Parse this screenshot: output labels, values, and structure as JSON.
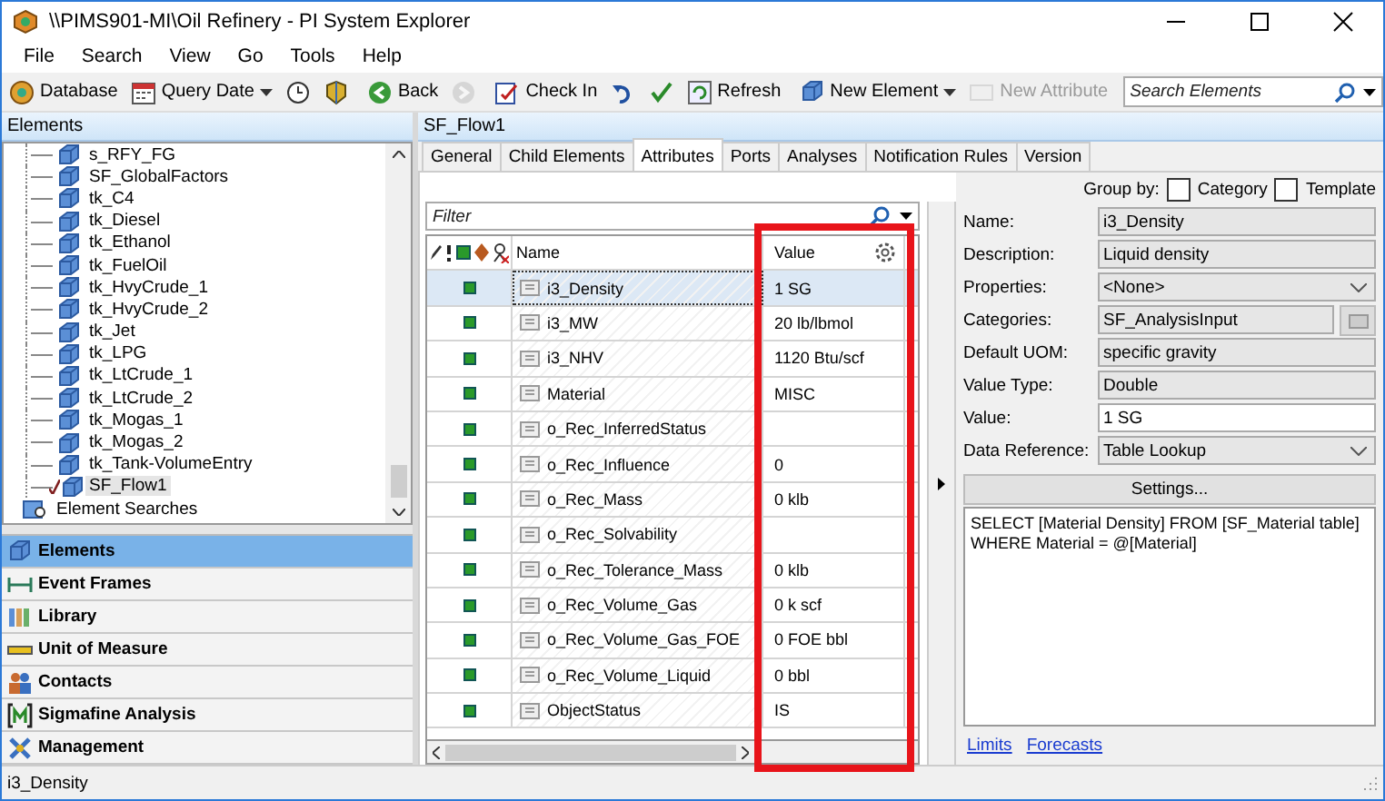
{
  "window": {
    "title": "\\\\PIMS901-MI\\Oil Refinery - PI System Explorer"
  },
  "menu": [
    "File",
    "Search",
    "View",
    "Go",
    "Tools",
    "Help"
  ],
  "toolbar": [
    {
      "kind": "button",
      "label": "Database",
      "disabled": false
    },
    {
      "kind": "dropdown",
      "label": "Query Date",
      "disabled": false
    },
    {
      "kind": "icon",
      "disabled": false
    },
    {
      "kind": "icon",
      "disabled": false
    },
    {
      "kind": "separator"
    },
    {
      "kind": "button",
      "label": "Back",
      "disabled": false
    },
    {
      "kind": "icon",
      "disabled": true
    },
    {
      "kind": "separator"
    },
    {
      "kind": "button",
      "label": "Check In",
      "disabled": false
    },
    {
      "kind": "icon",
      "disabled": false
    },
    {
      "kind": "icon",
      "disabled": false
    },
    {
      "kind": "button",
      "label": "Refresh",
      "disabled": false
    },
    {
      "kind": "separator"
    },
    {
      "kind": "dropdown",
      "label": "New Element",
      "disabled": false
    },
    {
      "kind": "button",
      "label": "New Attribute",
      "disabled": true
    },
    {
      "kind": "separator"
    }
  ],
  "search": {
    "placeholder": "Search Elements"
  },
  "elements_panel": {
    "title": "Elements",
    "tree": [
      {
        "label": "s_RFY_FG",
        "selected": false,
        "checked_out": false
      },
      {
        "label": "SF_GlobalFactors",
        "selected": false,
        "checked_out": false
      },
      {
        "label": "tk_C4",
        "selected": false,
        "checked_out": false
      },
      {
        "label": "tk_Diesel",
        "selected": false,
        "checked_out": false
      },
      {
        "label": "tk_Ethanol",
        "selected": false,
        "checked_out": false
      },
      {
        "label": "tk_FuelOil",
        "selected": false,
        "checked_out": false
      },
      {
        "label": "tk_HvyCrude_1",
        "selected": false,
        "checked_out": false
      },
      {
        "label": "tk_HvyCrude_2",
        "selected": false,
        "checked_out": false
      },
      {
        "label": "tk_Jet",
        "selected": false,
        "checked_out": false
      },
      {
        "label": "tk_LPG",
        "selected": false,
        "checked_out": false
      },
      {
        "label": "tk_LtCrude_1",
        "selected": false,
        "checked_out": false
      },
      {
        "label": "tk_LtCrude_2",
        "selected": false,
        "checked_out": false
      },
      {
        "label": "tk_Mogas_1",
        "selected": false,
        "checked_out": false
      },
      {
        "label": "tk_Mogas_2",
        "selected": false,
        "checked_out": false
      },
      {
        "label": "tk_Tank-VolumeEntry",
        "selected": false,
        "checked_out": false
      },
      {
        "label": "SF_Flow1",
        "selected": true,
        "checked_out": true
      }
    ],
    "searches": {
      "label": "Element Searches"
    }
  },
  "navigation": [
    {
      "label": "Elements",
      "selected": true
    },
    {
      "label": "Event Frames",
      "selected": false
    },
    {
      "label": "Library",
      "selected": false
    },
    {
      "label": "Unit of Measure",
      "selected": false
    },
    {
      "label": "Contacts",
      "selected": false
    },
    {
      "label": "Sigmafine Analysis",
      "selected": false
    },
    {
      "label": "Management",
      "selected": false
    }
  ],
  "details": {
    "title": "SF_Flow1",
    "tabs": [
      {
        "label": "General",
        "selected": false
      },
      {
        "label": "Child Elements",
        "selected": false
      },
      {
        "label": "Attributes",
        "selected": true
      },
      {
        "label": "Ports",
        "selected": false
      },
      {
        "label": "Analyses",
        "selected": false
      },
      {
        "label": "Notification Rules",
        "selected": false
      },
      {
        "label": "Version",
        "selected": false
      }
    ],
    "filter": {
      "placeholder": "Filter"
    },
    "table": {
      "columns": [
        "Name",
        "Value"
      ],
      "rows": [
        {
          "name": "i3_Density",
          "value": "1 SG",
          "selected": true
        },
        {
          "name": "i3_MW",
          "value": "20 lb/lbmol",
          "selected": false
        },
        {
          "name": "i3_NHV",
          "value": "1120 Btu/scf",
          "selected": false
        },
        {
          "name": "Material",
          "value": "MISC",
          "selected": false
        },
        {
          "name": "o_Rec_InferredStatus",
          "value": "",
          "selected": false
        },
        {
          "name": "o_Rec_Influence",
          "value": "0",
          "selected": false
        },
        {
          "name": "o_Rec_Mass",
          "value": "0 klb",
          "selected": false
        },
        {
          "name": "o_Rec_Solvability",
          "value": "",
          "selected": false
        },
        {
          "name": "o_Rec_Tolerance_Mass",
          "value": "0 klb",
          "selected": false
        },
        {
          "name": "o_Rec_Volume_Gas",
          "value": "0 k scf",
          "selected": false
        },
        {
          "name": "o_Rec_Volume_Gas_FOE",
          "value": "0 FOE bbl",
          "selected": false
        },
        {
          "name": "o_Rec_Volume_Liquid",
          "value": "0 bbl",
          "selected": false
        },
        {
          "name": "ObjectStatus",
          "value": "IS",
          "selected": false
        }
      ]
    },
    "properties": {
      "group_by": "Group by:",
      "group_options": [
        {
          "label": "Category",
          "checked": false
        },
        {
          "label": "Template",
          "checked": false
        }
      ],
      "fields": [
        {
          "label": "Name:",
          "value": "i3_Density",
          "kind": "readonly"
        },
        {
          "label": "Description:",
          "value": "Liquid density",
          "kind": "readonly"
        },
        {
          "label": "Properties:",
          "value": "<None>",
          "kind": "dropdown"
        },
        {
          "label": "Categories:",
          "value": "SF_AnalysisInput",
          "kind": "browse"
        },
        {
          "label": "Default UOM:",
          "value": "specific gravity",
          "kind": "readonly"
        },
        {
          "label": "Value Type:",
          "value": "Double",
          "kind": "readonly"
        },
        {
          "label": "Value:",
          "value": "1 SG",
          "kind": "input"
        },
        {
          "label": "Data Reference:",
          "value": "Table Lookup",
          "kind": "dropdown"
        }
      ],
      "settings_button": "Settings...",
      "config": "SELECT [Material Density] FROM [SF_Material table] WHERE Material = @[Material]",
      "links": [
        "Limits",
        "Forecasts"
      ]
    }
  },
  "status_bar": {
    "text": "i3_Density"
  }
}
